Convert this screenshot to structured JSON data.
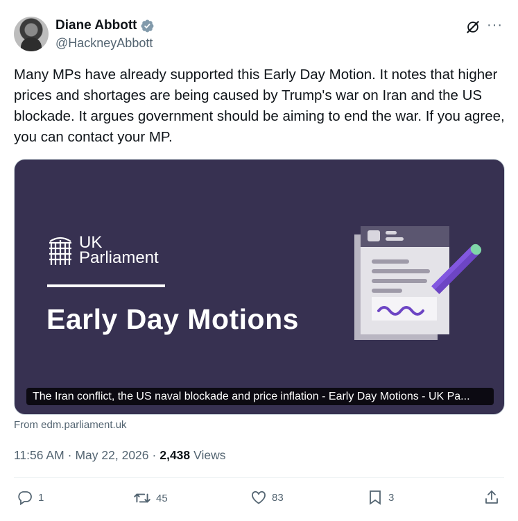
{
  "author": {
    "name": "Diane Abbott",
    "handle": "@HackneyAbbott"
  },
  "tweet": {
    "text": "Many MPs have already supported this Early Day Motion. It notes that higher prices and shortages are being caused by Trump's war on Iran and the US blockade. It argues government should be aiming to end the war. If you agree, you can contact your MP."
  },
  "card": {
    "logo_line1": "UK",
    "logo_line2": "Parliament",
    "title": "Early Day Motions",
    "caption": "The Iran conflict, the US naval blockade and price inflation - Early Day Motions - UK Pa...",
    "source": "From edm.parliament.uk",
    "bg_color": "#373151"
  },
  "meta": {
    "time": "11:56 AM",
    "sep1": "·",
    "date": "May 22, 2026",
    "sep2": "·",
    "views_count": "2,438",
    "views_label": "Views"
  },
  "actions": {
    "replies": "1",
    "reposts": "45",
    "likes": "83",
    "bookmarks": "3"
  },
  "icons": [
    "verified-badge-icon",
    "grok-icon",
    "more-icon",
    "reply-icon",
    "repost-icon",
    "like-icon",
    "bookmark-icon",
    "share-icon",
    "portcullis-icon"
  ],
  "colors": {
    "verified": "#829aab",
    "secondary_text": "#536471",
    "accent_purple": "#6d45c4"
  }
}
